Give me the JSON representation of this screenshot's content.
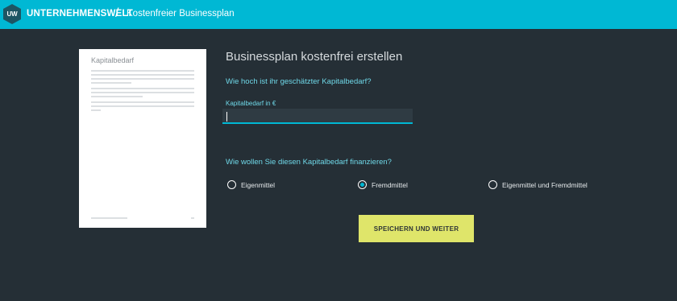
{
  "header": {
    "logo_text": "UW",
    "brand": "UNTERNEHMENSWELT",
    "separator": "/",
    "subtitle": "Kostenfreier Businessplan"
  },
  "preview": {
    "title": "Kapitalbedarf"
  },
  "form": {
    "title": "Businessplan kostenfrei erstellen",
    "question_capital": "Wie hoch ist ihr geschätzter Kapitalbedarf?",
    "field_label": "Kapitalbedarf in €",
    "field_value": "",
    "field_placeholder": "",
    "question_financing": "Wie wollen Sie diesen Kapitalbedarf finanzieren?",
    "options": [
      {
        "label": "Eigenmittel",
        "checked": false
      },
      {
        "label": "Fremdmittel",
        "checked": true
      },
      {
        "label": "Eigenmittel und Fremdmittel",
        "checked": false
      }
    ],
    "submit_label": "SPEICHERN UND WEITER"
  },
  "colors": {
    "background": "#252f36",
    "header": "#00b8d4",
    "accent_text": "#6fd8e8",
    "button": "#dfe56a"
  }
}
